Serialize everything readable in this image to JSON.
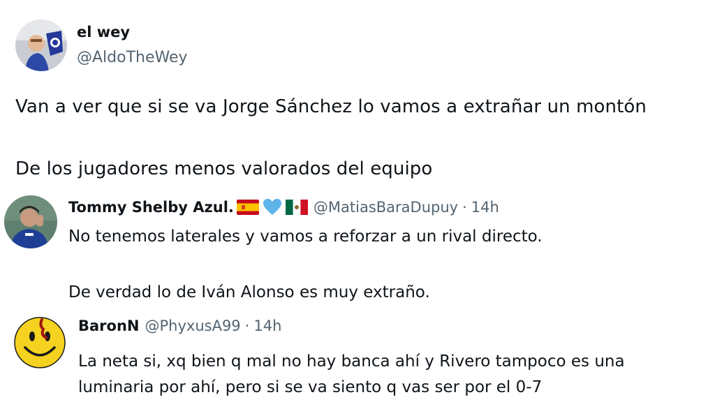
{
  "main_tweet": {
    "display_name": "el wey",
    "handle": "@AldoTheWey",
    "text_lines": [
      "Van a ver que si se va Jorge Sánchez lo vamos a extrañar un montón",
      "De los jugadores menos valorados del equipo"
    ]
  },
  "replies": [
    {
      "display_name": "Tommy Shelby Azul.",
      "name_icons": [
        "spain-flag-icon",
        "light-blue-heart-icon",
        "mexico-flag-icon"
      ],
      "handle": "@MatiasBaraDupuy",
      "separator": "·",
      "time": "14h",
      "text_lines": [
        "No tenemos laterales y vamos a reforzar a un rival directo.",
        "De verdad lo de Iván Alonso es muy extraño."
      ]
    },
    {
      "display_name": "BaronN",
      "handle": "@PhyxusA99",
      "separator": "·",
      "time": "14h",
      "text_lines": [
        "La neta si, xq bien q mal no hay banca ahí y Rivero tampoco es una",
        "luminaria por ahí, pero si se va siento q vas ser por el 0-7"
      ]
    }
  ],
  "colors": {
    "text": "#0f1419",
    "secondary": "#536471",
    "heart": "#5db4e8",
    "smiley": "#f5d21f"
  }
}
